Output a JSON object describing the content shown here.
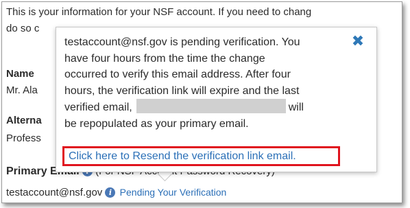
{
  "intro": {
    "line1": "This is your information for your NSF account. If you need to chang",
    "line2": "do so c"
  },
  "name": {
    "label": "Name",
    "value": "Mr. Ala"
  },
  "alternate": {
    "label": "Alterna",
    "value": "Profess"
  },
  "primary_email": {
    "label": "Primary Email",
    "info_icon": "i",
    "note": "(For NSF Account Password Recovery)",
    "value": "testaccount@nsf.gov",
    "pending_text": "Pending Your Verification"
  },
  "popover": {
    "lines": [
      "testaccount@nsf.gov is pending verification. You",
      "have four hours from the time the change",
      "occurred to verify this email address. After four",
      "hours, the verification link will expire and the last"
    ],
    "line5_start": "verified email,",
    "line5_end": "will",
    "line6": "be repopulated as your primary email.",
    "close_glyph": "✖",
    "resend_link": "Click here to Resend the verification link email."
  },
  "colors": {
    "link": "#2b6fb7",
    "highlight_border": "#e0141e",
    "info_icon": "#4a78b6"
  }
}
